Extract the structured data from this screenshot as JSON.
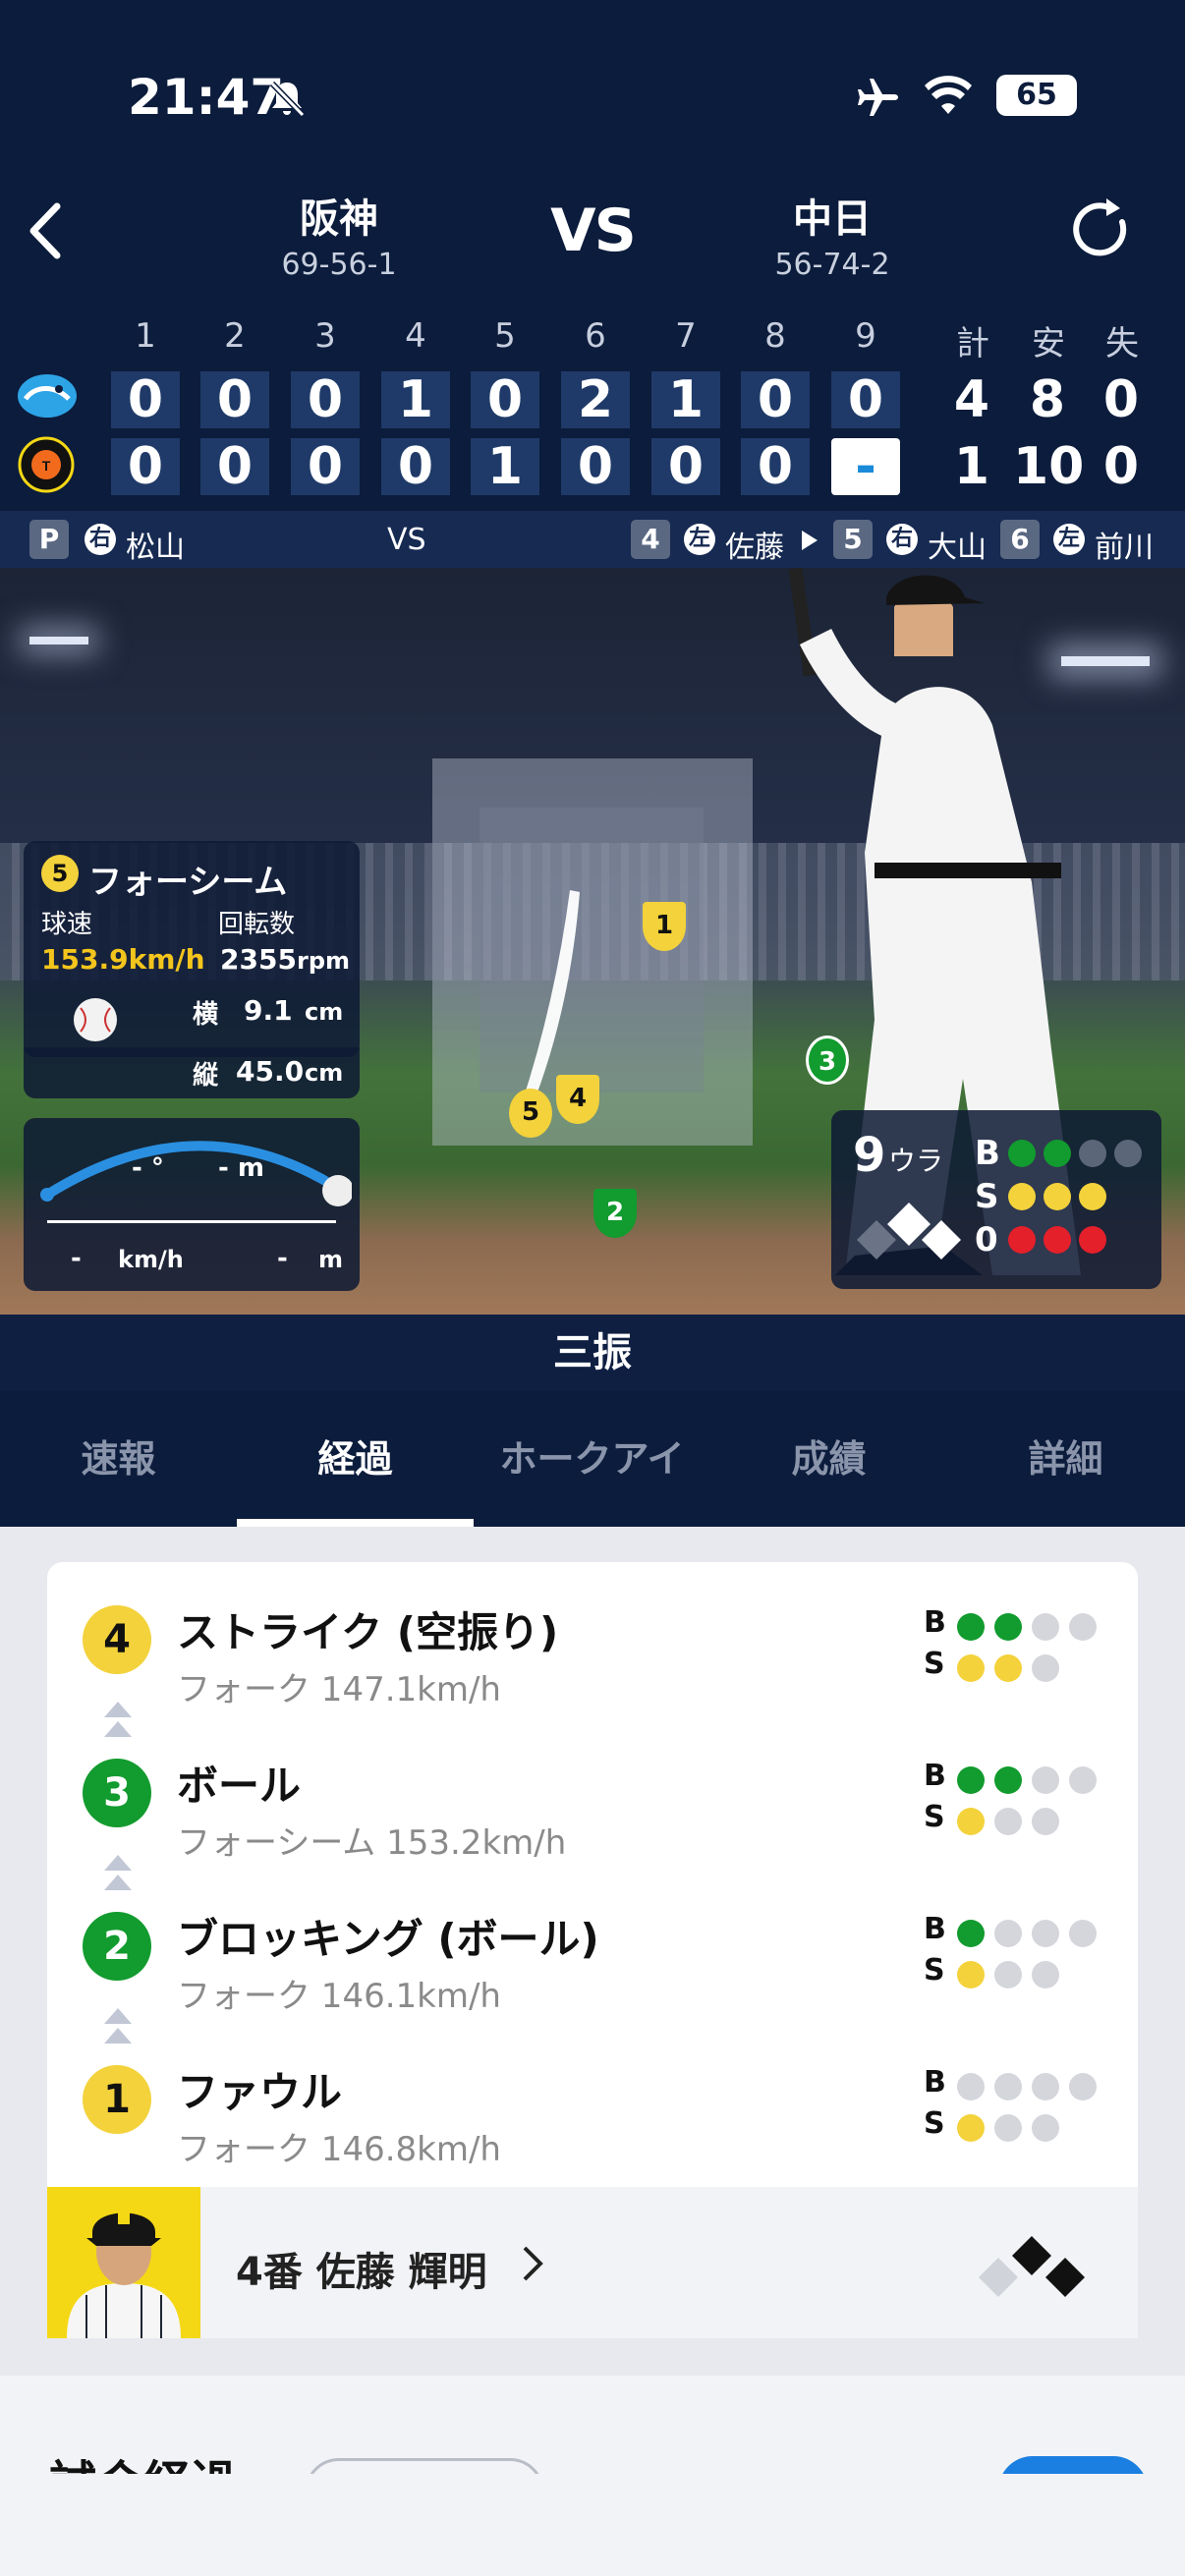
{
  "status": {
    "time": "21:47",
    "battery": "65"
  },
  "header": {
    "home": {
      "name": "阪神",
      "record": "69-56-1"
    },
    "away": {
      "name": "中日",
      "record": "56-74-2"
    },
    "vs": "VS"
  },
  "scoreboard": {
    "innings": [
      "1",
      "2",
      "3",
      "4",
      "5",
      "6",
      "7",
      "8",
      "9"
    ],
    "totals_labels": [
      "計",
      "安",
      "失"
    ],
    "rows": [
      {
        "team": "中日",
        "scores": [
          "0",
          "0",
          "0",
          "1",
          "0",
          "2",
          "1",
          "0",
          "0"
        ],
        "totals": [
          "4",
          "8",
          "0"
        ]
      },
      {
        "team": "阪神",
        "scores": [
          "0",
          "0",
          "0",
          "0",
          "1",
          "0",
          "0",
          "0",
          "-"
        ],
        "totals": [
          "1",
          "10",
          "0"
        ]
      }
    ]
  },
  "players_row": {
    "pitcher_badge": "P",
    "pitcher_hand": "右",
    "pitcher_name": "松山",
    "vs": "VS",
    "batters": [
      {
        "num": "4",
        "hand": "左",
        "name": "佐藤"
      },
      {
        "num": "5",
        "hand": "右",
        "name": "大山"
      },
      {
        "num": "6",
        "hand": "左",
        "name": "前川"
      }
    ]
  },
  "pitch_info": {
    "pitch_no": "5",
    "pitch_type": "フォーシーム",
    "speed_label": "球速",
    "speed_value": "153.9km/h",
    "spin_label": "回転数",
    "spin_value": "2355",
    "spin_unit": "rpm",
    "h_label": "横",
    "h_value": "9.1",
    "h_unit": "cm",
    "v_label": "縦",
    "v_value": "45.0",
    "v_unit": "cm"
  },
  "hit_info": {
    "angle": "- °",
    "distance": "- m",
    "exit_speed": "-",
    "exit_unit": "km/h",
    "range": "-",
    "range_unit": "m"
  },
  "zone_markers": [
    "1",
    "2",
    "3",
    "4",
    "5"
  ],
  "count_box": {
    "inning": "9",
    "half": "ウラ",
    "b": "B",
    "s": "S",
    "o": "0",
    "balls": 2,
    "strikes": 3,
    "outs": 3
  },
  "result_text": "三振",
  "tabs": [
    {
      "label": "速報"
    },
    {
      "label": "経過"
    },
    {
      "label": "ホークアイ"
    },
    {
      "label": "成績"
    },
    {
      "label": "詳細"
    }
  ],
  "colors": {
    "navy": "#0c1c3c",
    "green": "#129b2e",
    "yellow": "#f3d23b",
    "red": "#e4202a"
  },
  "events": [
    {
      "num": "4",
      "title": "ストライク (空振り)",
      "sub": "フォーク 147.1km/h",
      "color": "yellow",
      "balls": 2,
      "strikes": 2
    },
    {
      "num": "3",
      "title": "ボール",
      "sub": "フォーシーム 153.2km/h",
      "color": "green",
      "balls": 2,
      "strikes": 1
    },
    {
      "num": "2",
      "title": "ブロッキング (ボール)",
      "sub": "フォーク 146.1km/h",
      "color": "green",
      "balls": 1,
      "strikes": 1
    },
    {
      "num": "1",
      "title": "ファウル",
      "sub": "フォーク 146.8km/h",
      "color": "yellow",
      "balls": 0,
      "strikes": 1
    }
  ],
  "batter_row": {
    "label": "4番 佐藤 輝明"
  },
  "footer": {
    "section_title": "試合経過"
  }
}
